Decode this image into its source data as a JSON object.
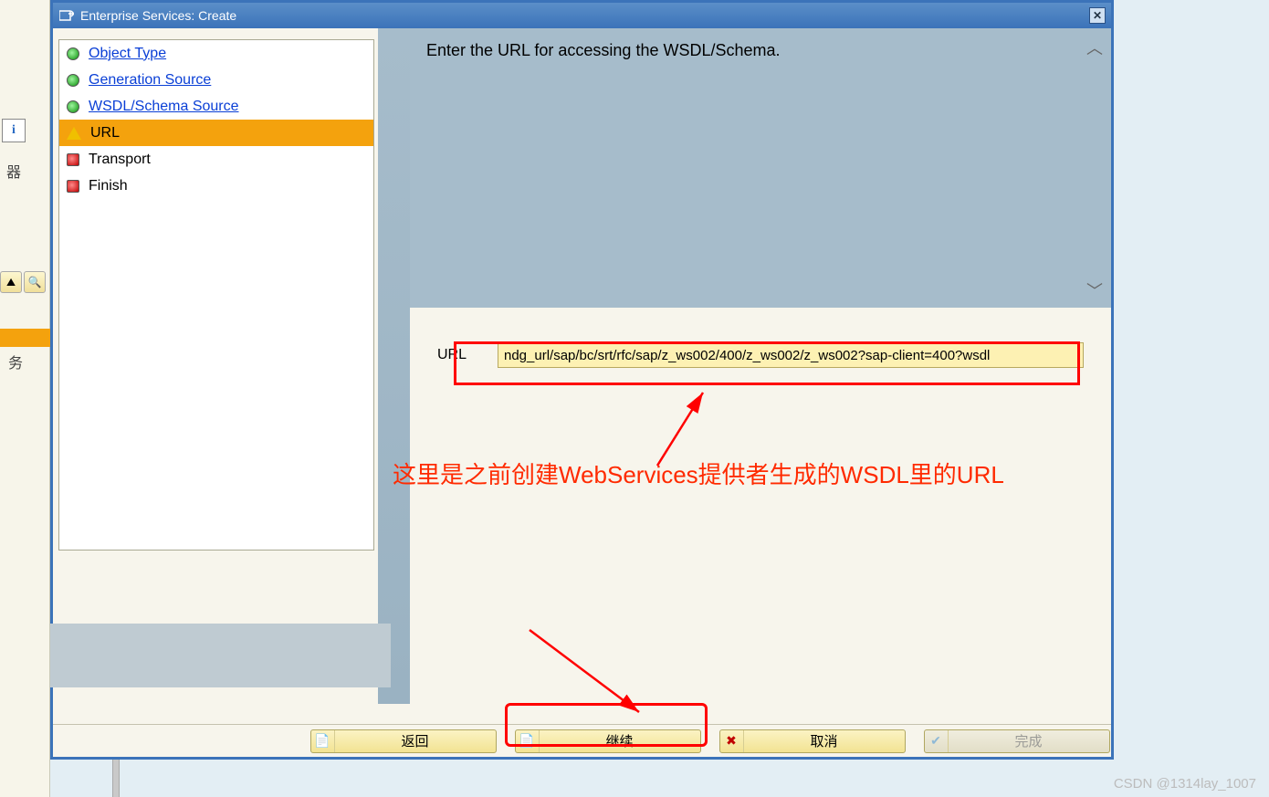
{
  "titlebar": {
    "title": "Enterprise Services: Create"
  },
  "bg": {
    "info_glyph": "i",
    "label1": "器",
    "label2": "务",
    "tool1": "⛰",
    "tool2": "🔍"
  },
  "steps": [
    {
      "label": "Object Type",
      "state": "done"
    },
    {
      "label": "Generation Source",
      "state": "done"
    },
    {
      "label": "WSDL/Schema Source",
      "state": "done"
    },
    {
      "label": "URL",
      "state": "active"
    },
    {
      "label": "Transport",
      "state": "todo"
    },
    {
      "label": "Finish",
      "state": "todo"
    }
  ],
  "instruction_text": "Enter the URL for accessing the WSDL/Schema.",
  "scroll_up_glyph": "︿",
  "scroll_dn_glyph": "﹀",
  "url_label": "URL",
  "url_value": "ndg_url/sap/bc/srt/rfc/sap/z_ws002/400/z_ws002/z_ws002?sap-client=400?wsdl",
  "annotation_text": "这里是之前创建WebServices提供者生成的WSDL里的URL",
  "buttons": {
    "back": {
      "label": "返回",
      "icon": "📄"
    },
    "next": {
      "label": "继续",
      "icon": "📄"
    },
    "cancel": {
      "label": "取消",
      "icon": "✖"
    },
    "finish": {
      "label": "完成",
      "icon": "✔"
    }
  },
  "watermark": "CSDN @1314lay_1007"
}
